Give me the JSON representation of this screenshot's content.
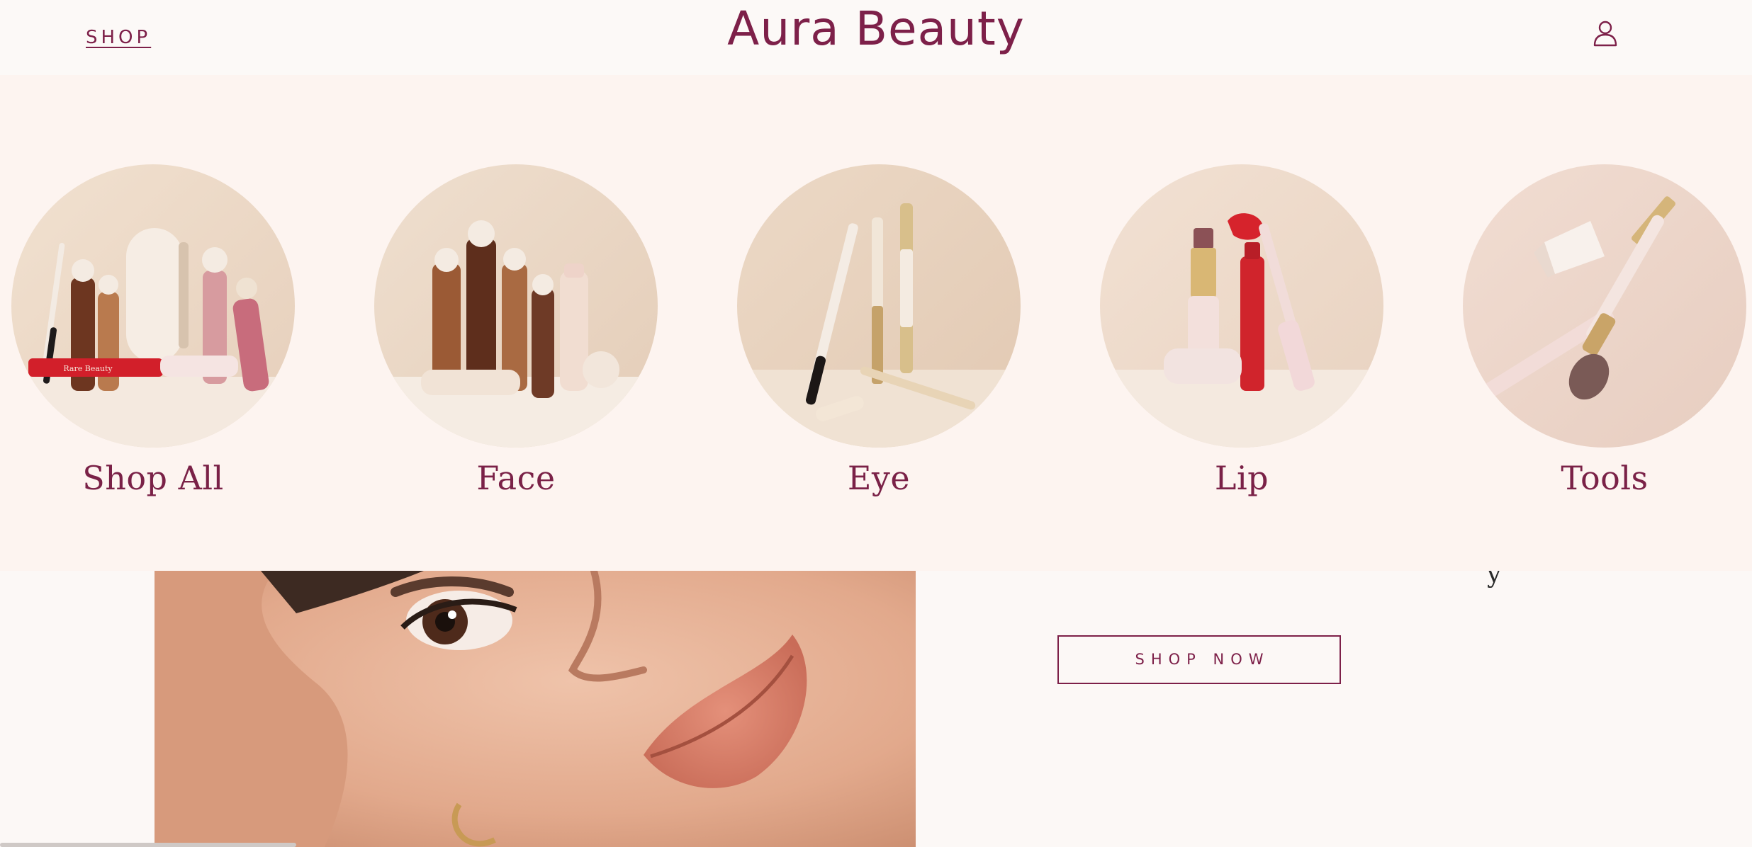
{
  "header": {
    "shop_label": "SHOP",
    "brand": "Aura Beauty",
    "account_icon": "user-account-icon"
  },
  "categories": [
    {
      "label": "Shop All"
    },
    {
      "label": "Face"
    },
    {
      "label": "Eye"
    },
    {
      "label": "Lip"
    },
    {
      "label": "Tools"
    }
  ],
  "product_label": "Rare Beauty",
  "hero": {
    "cta_label": "SHOP NOW",
    "text_fragment": "y"
  },
  "colors": {
    "brand": "#7d2049",
    "band_background": "#fdf4f0",
    "page_background": "#fcf8f6"
  }
}
